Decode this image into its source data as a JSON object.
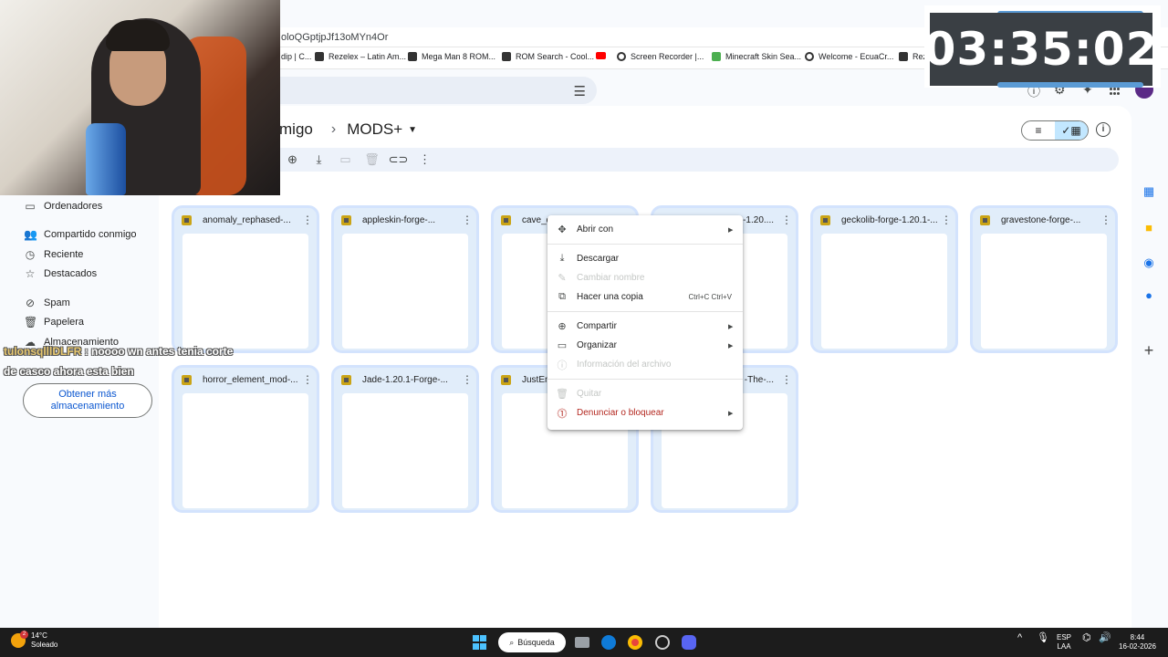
{
  "browser": {
    "url_fragment": "oloQGptjpJf13oMYn4Or",
    "bookmarks": [
      {
        "label": "dip | C...",
        "icon": "bookmark-icon"
      },
      {
        "label": "Rezelex – Latin Am...",
        "icon": "rezelex-icon"
      },
      {
        "label": "Mega Man 8 ROM...",
        "icon": "rom-icon"
      },
      {
        "label": "ROM Search - Cool...",
        "icon": "rom-search-icon"
      },
      {
        "label": "",
        "icon": "youtube-icon"
      },
      {
        "label": "Screen Recorder |...",
        "icon": "screen-recorder-icon"
      },
      {
        "label": "Minecraft Skin Sea...",
        "icon": "minecraft-icon"
      },
      {
        "label": "Welcome - EcuaCr...",
        "icon": "ecuacraft-icon"
      },
      {
        "label": "Rezelex – Latin A...",
        "icon": "rezelex-icon"
      }
    ]
  },
  "drive": {
    "breadcrumb_parent": "migo",
    "current_folder": "MODS+",
    "toolbar": [
      "share-icon",
      "download-icon",
      "move-icon",
      "trash-icon",
      "link-icon",
      "more-icon"
    ],
    "sidebar": {
      "computers": "Ordenadores",
      "shared": "Compartido conmigo",
      "recent": "Reciente",
      "starred": "Destacados",
      "spam": "Spam",
      "trash": "Papelera",
      "storage": "Almacenamiento",
      "get_more": "Obtener más almacenamiento"
    },
    "files": [
      {
        "name": "anomaly_rephased-..."
      },
      {
        "name": "appleskin-forge-..."
      },
      {
        "name": "cave_d"
      },
      {
        "name": "e-1.20...."
      },
      {
        "name": "geckolib-forge-1.20.1-..."
      },
      {
        "name": "gravestone-forge-..."
      },
      {
        "name": "horror_element_mod-..."
      },
      {
        "name": "Jade-1.20.1-Forge-..."
      },
      {
        "name": "JustEn"
      },
      {
        "name": "-The-..."
      }
    ],
    "context_menu": {
      "open_with": "Abrir con",
      "download": "Descargar",
      "rename": "Cambiar nombre",
      "copy": "Hacer una copia",
      "copy_shortcut": "Ctrl+C Ctrl+V",
      "share": "Compartir",
      "organize": "Organizar",
      "file_info": "Información del archivo",
      "remove": "Quitar",
      "report": "Denunciar o bloquear"
    }
  },
  "overlay": {
    "timer": "03:35:02",
    "chat_user": "tulonsqlllDLFR",
    "chat_line1": ": noooo wn antes tenia corte",
    "chat_line2": "de casco ahora esta bien"
  },
  "taskbar": {
    "temp": "14°C",
    "weather": "Soleado",
    "weather_badge": "2",
    "search": "Búsqueda",
    "lang1": "ESP",
    "lang2": "LAA",
    "time": "8:44",
    "date": "16-02-2026"
  },
  "colors": {
    "accent": "#0b57d0",
    "card_border": "#d3e3fd",
    "danger": "#b3261e",
    "selected_view": "#c2e7ff"
  }
}
